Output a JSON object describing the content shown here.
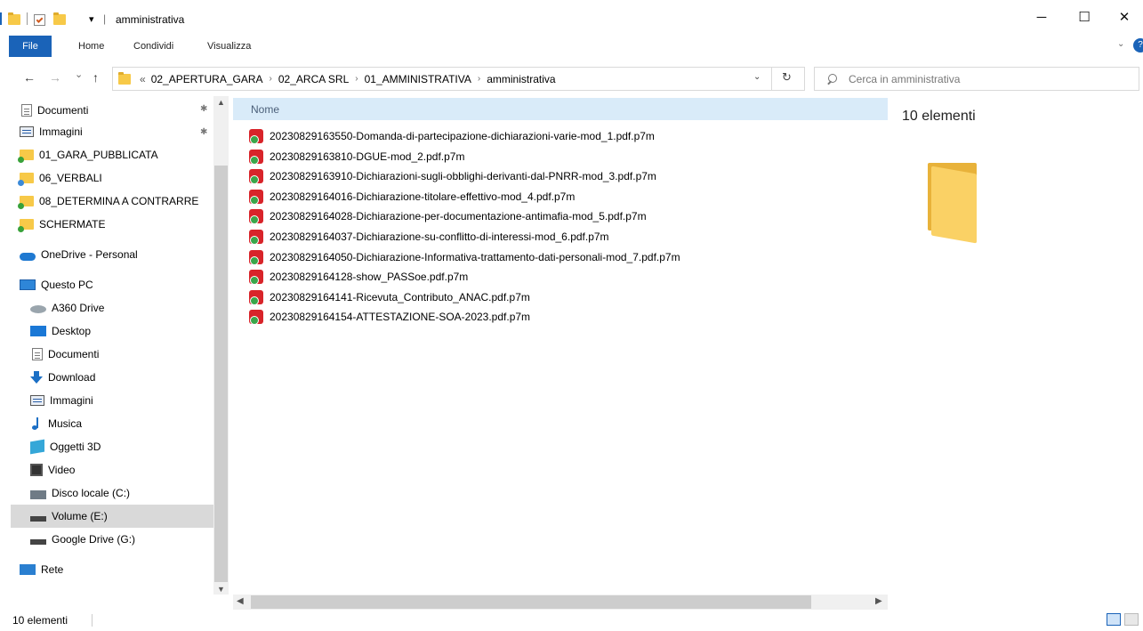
{
  "window": {
    "title": "amministrativa",
    "qa_separator": "|",
    "qa_dropdown": "▾",
    "minimize": "─",
    "maximize": "☐",
    "close": "✕"
  },
  "ribbon": {
    "tabs": [
      "File",
      "Home",
      "Condividi",
      "Visualizza"
    ],
    "help": "?"
  },
  "address": {
    "prefix": "«",
    "crumbs": [
      "02_APERTURA_GARA",
      "02_ARCA SRL",
      "01_AMMINISTRATIVA",
      "amministrativa"
    ],
    "separator": "›",
    "search_placeholder": "Cerca in amministrativa"
  },
  "nav": {
    "back": "←",
    "forward": "→",
    "recent": "⌄",
    "up": "↑",
    "items": [
      {
        "label": "Documenti",
        "icon": "document-icon",
        "pinned": true
      },
      {
        "label": "Immagini",
        "icon": "pictures-icon",
        "pinned": true
      },
      {
        "label": "01_GARA_PUBBLICATA",
        "icon": "synced-folder-icon"
      },
      {
        "label": "06_VERBALI",
        "icon": "syncing-folder-icon"
      },
      {
        "label": "08_DETERMINA A CONTRARRE",
        "icon": "synced-folder-icon"
      },
      {
        "label": "SCHERMATE",
        "icon": "synced-folder-icon"
      },
      {
        "label": "OneDrive - Personal",
        "icon": "onedrive-cloud-icon"
      },
      {
        "label": "Questo PC",
        "icon": "this-pc-icon"
      },
      {
        "label": "A360 Drive",
        "icon": "a360-drive-icon"
      },
      {
        "label": "Desktop",
        "icon": "desktop-icon"
      },
      {
        "label": "Documenti",
        "icon": "document-icon"
      },
      {
        "label": "Download",
        "icon": "download-icon"
      },
      {
        "label": "Immagini",
        "icon": "pictures-icon"
      },
      {
        "label": "Musica",
        "icon": "music-icon"
      },
      {
        "label": "Oggetti 3D",
        "icon": "3d-objects-icon"
      },
      {
        "label": "Video",
        "icon": "video-icon"
      },
      {
        "label": "Disco locale (C:)",
        "icon": "local-disk-icon"
      },
      {
        "label": "Volume (E:)",
        "icon": "volume-drive-icon",
        "selected": true
      },
      {
        "label": "Google Drive (G:)",
        "icon": "google-drive-icon"
      },
      {
        "label": "Rete",
        "icon": "network-icon"
      }
    ]
  },
  "columns": {
    "name": "Nome"
  },
  "files": [
    "20230829163550-Domanda-di-partecipazione-dichiarazioni-varie-mod_1.pdf.p7m",
    "20230829163810-DGUE-mod_2.pdf.p7m",
    "20230829163910-Dichiarazioni-sugli-obblighi-derivanti-dal-PNRR-mod_3.pdf.p7m",
    "20230829164016-Dichiarazione-titolare-effettivo-mod_4.pdf.p7m",
    "20230829164028-Dichiarazione-per-documentazione-antimafia-mod_5.pdf.p7m",
    "20230829164037-Dichiarazione-su-conflitto-di-interessi-mod_6.pdf.p7m",
    "20230829164050-Dichiarazione-Informativa-trattamento-dati-personali-mod_7.pdf.p7m",
    "20230829164128-show_PASSoe.pdf.p7m",
    "20230829164141-Ricevuta_Contributo_ANAC.pdf.p7m",
    "20230829164154-ATTESTAZIONE-SOA-2023.pdf.p7m"
  ],
  "preview": {
    "count": "10 elementi"
  },
  "status": {
    "count": "10 elementi"
  },
  "colors": {
    "accent": "#1a63b8",
    "header_bg": "#d9ebf9",
    "selected_bg": "#d9d9d9",
    "folder": "#f7c948"
  }
}
